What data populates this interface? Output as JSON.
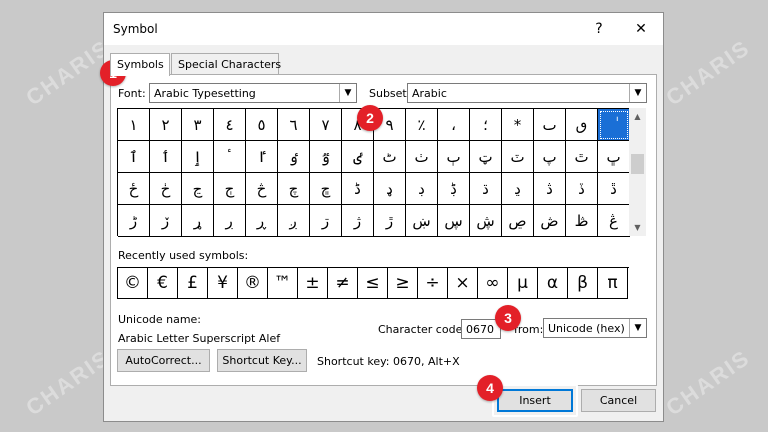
{
  "dialog": {
    "title": "Symbol",
    "help_button": "?",
    "close_button": "✕"
  },
  "watermark": "CHARIS",
  "tabs": [
    {
      "label": "Symbols",
      "active": true
    },
    {
      "label": "Special Characters",
      "active": false
    }
  ],
  "font": {
    "label": "Font:",
    "value": "Arabic Typesetting"
  },
  "subset": {
    "label": "Subset:",
    "value": "Arabic"
  },
  "symbol_grid": [
    [
      "١",
      "٢",
      "٣",
      "٤",
      "٥",
      "٦",
      "٧",
      "٨",
      "٩",
      "٪",
      "،",
      "؛",
      "*",
      "ٮ",
      "ٯ",
      "ٰ"
    ],
    [
      "ٱ",
      "ٲ",
      "ٳ",
      "ٴ",
      "ٵ",
      "ٶ",
      "ٷ",
      "ٸ",
      "ٹ",
      "ٺ",
      "ٻ",
      "ټ",
      "ٽ",
      "پ",
      "ٿ",
      "ڀ"
    ],
    [
      "ځ",
      "ڂ",
      "ڃ",
      "ڄ",
      "څ",
      "چ",
      "ڇ",
      "ڈ",
      "ډ",
      "ڊ",
      "ڋ",
      "ڌ",
      "ڍ",
      "ڎ",
      "ڏ",
      "ڐ"
    ],
    [
      "ڑ",
      "ڒ",
      "ړ",
      "ڔ",
      "ڕ",
      "ږ",
      "ڗ",
      "ژ",
      "ڙ",
      "ښ",
      "ڛ",
      "ڜ",
      "ڝ",
      "ڞ",
      "ڟ",
      "ڠ"
    ]
  ],
  "selected_symbol": "ٰ",
  "recent": {
    "label": "Recently used symbols:",
    "symbols": [
      "©",
      "€",
      "£",
      "¥",
      "®",
      "™",
      "±",
      "≠",
      "≤",
      "≥",
      "÷",
      "×",
      "∞",
      "µ",
      "α",
      "β",
      "π"
    ]
  },
  "unicode": {
    "name_label": "Unicode name:",
    "name_value": "Arabic Letter Superscript Alef"
  },
  "character_code": {
    "label": "Character code:",
    "value": "0670"
  },
  "from": {
    "label": "from:",
    "value": "Unicode (hex)"
  },
  "buttons": {
    "autocorrect": "AutoCorrect...",
    "shortcut_key": "Shortcut Key...",
    "insert": "Insert",
    "cancel": "Cancel"
  },
  "shortcut_text": "Shortcut key: 0670, Alt+X",
  "badges": [
    "1",
    "2",
    "3",
    "4"
  ],
  "colors": {
    "badge": "#e32028",
    "selection": "#1a6fd6",
    "default_button_border": "#0078d7"
  }
}
